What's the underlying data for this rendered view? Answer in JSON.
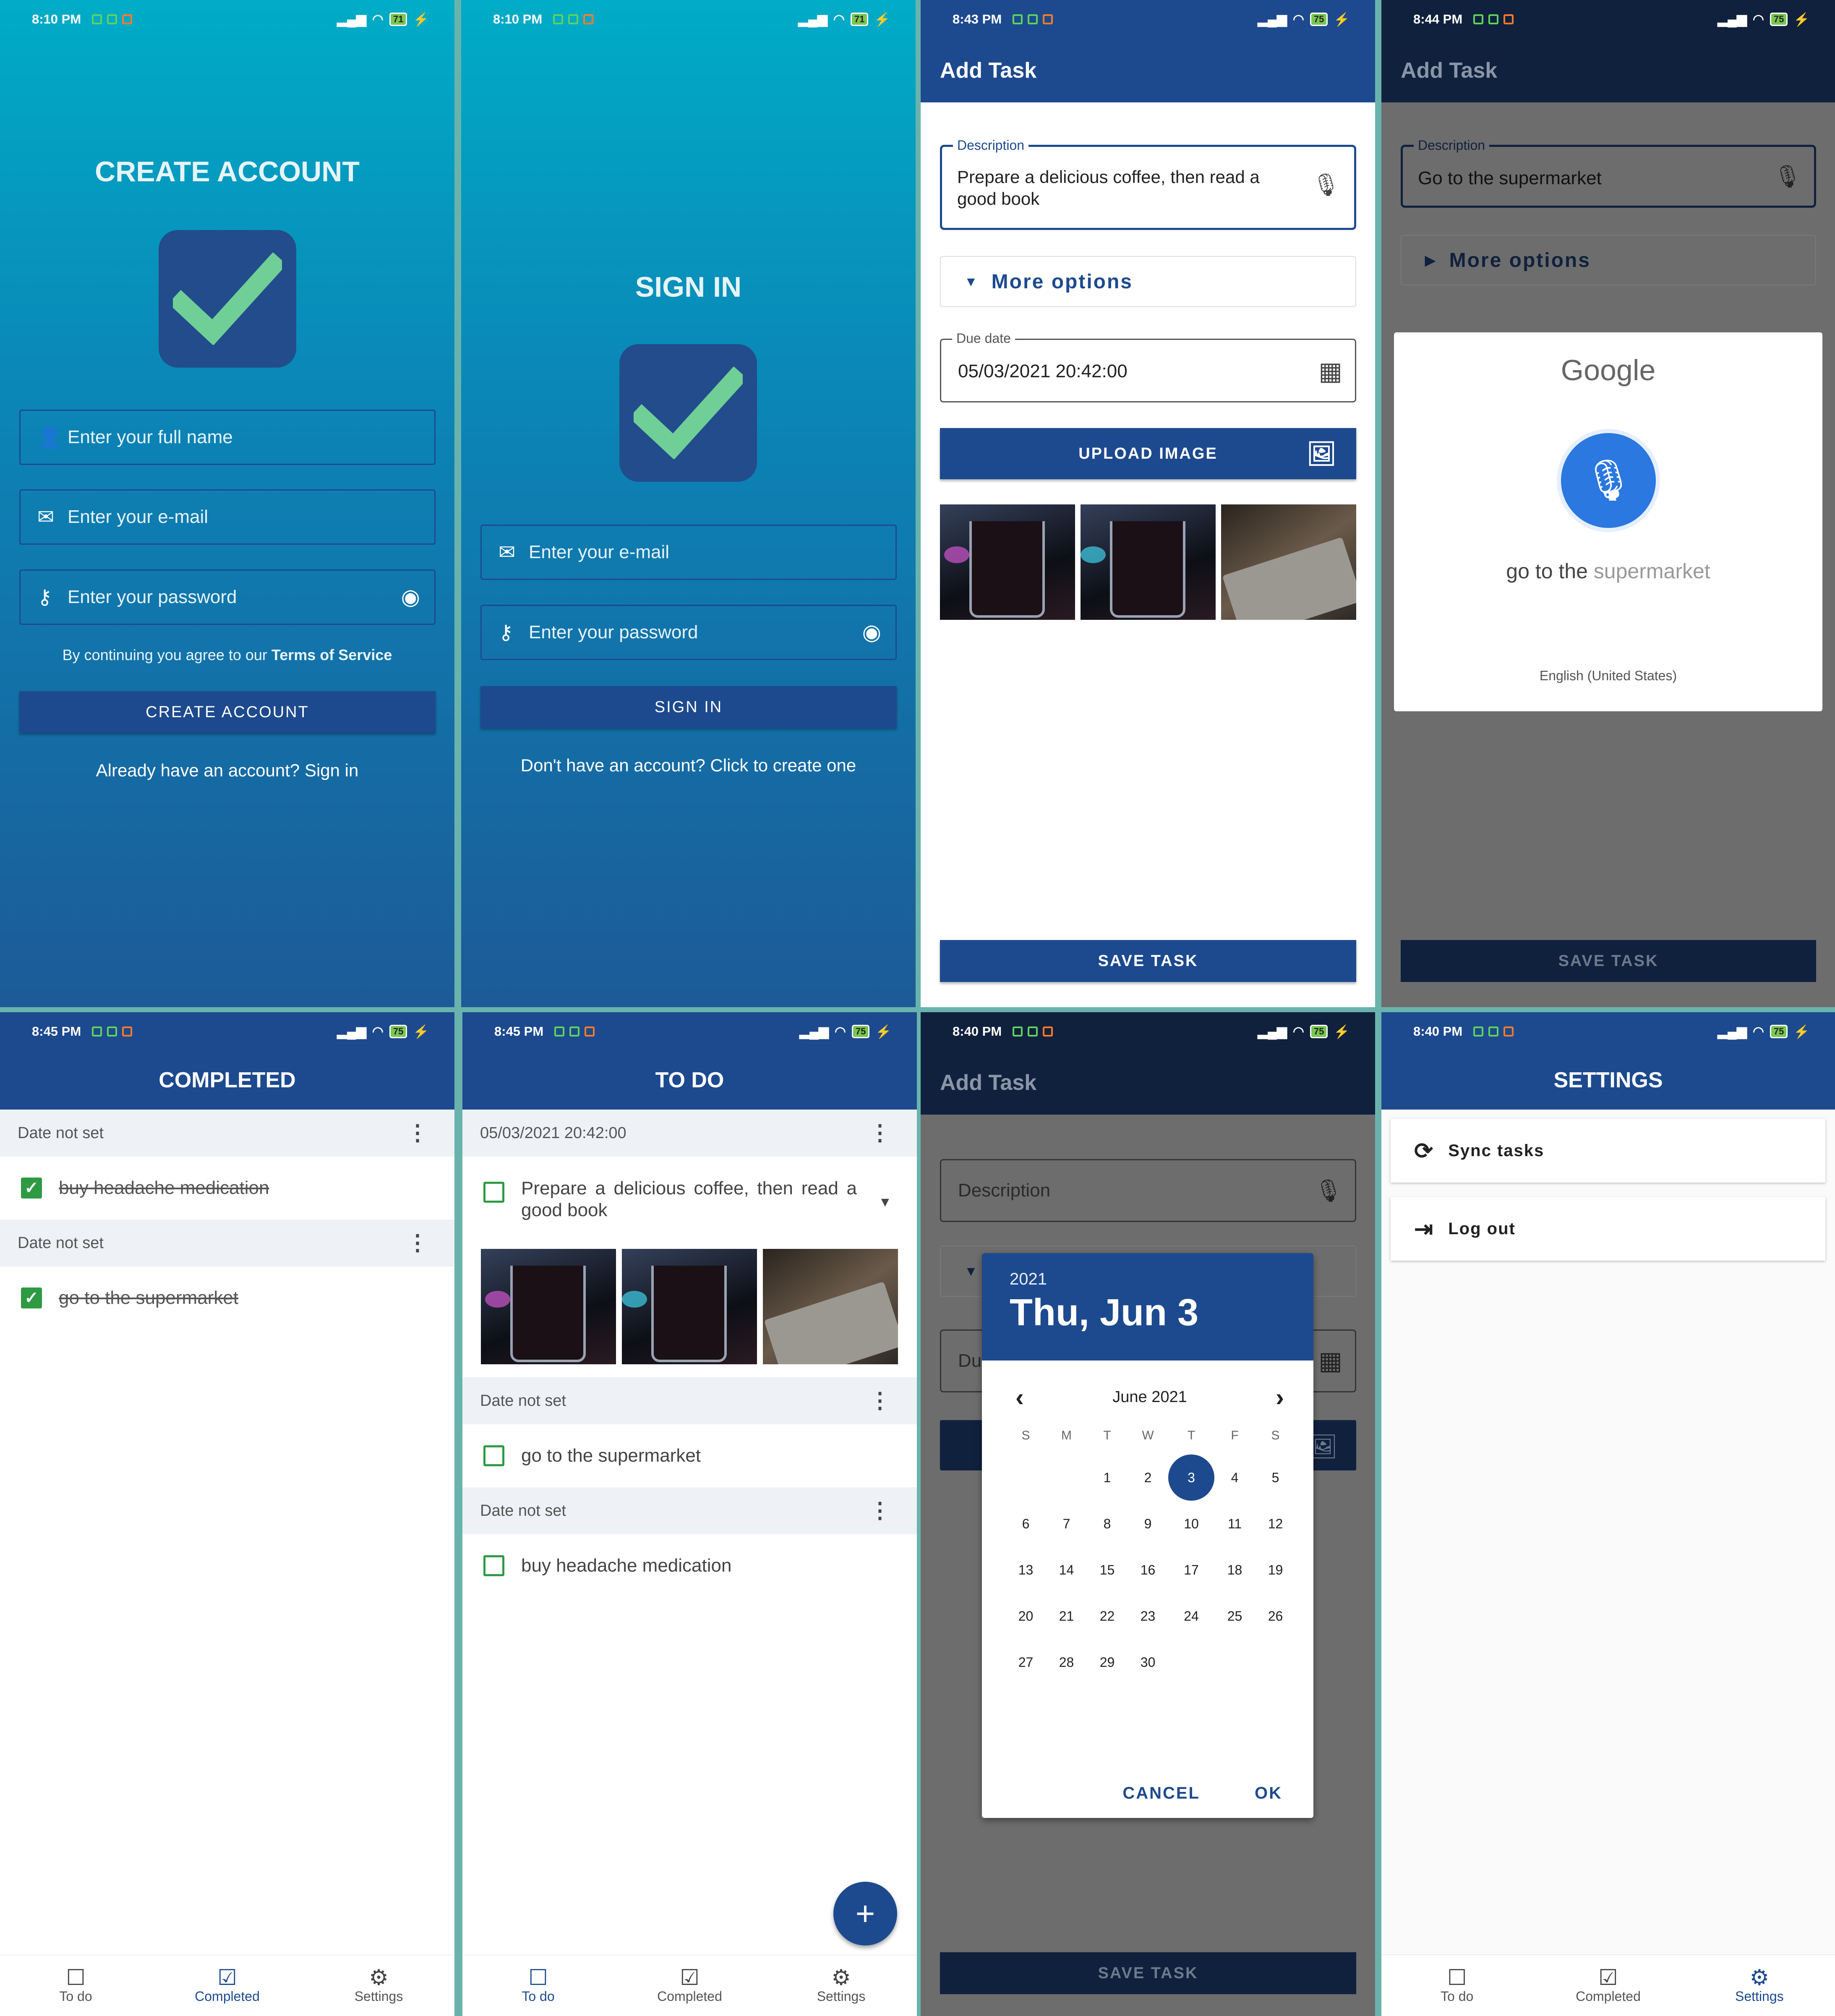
{
  "colors": {
    "primary": "#1d4a8e",
    "success": "#2e9a44",
    "accent": "#6fcf97"
  },
  "create_account": {
    "status_time": "8:10 PM",
    "battery": "71",
    "title": "CREATE ACCOUNT",
    "name_placeholder": "Enter your full name",
    "email_placeholder": "Enter your e-mail",
    "password_placeholder": "Enter your password",
    "terms_prefix": "By continuing you agree to our ",
    "terms_link": "Terms of Service",
    "button": "CREATE ACCOUNT",
    "signin_link": "Already have an account? Sign in"
  },
  "sign_in": {
    "status_time": "8:10 PM",
    "battery": "71",
    "title": "SIGN IN",
    "email_placeholder": "Enter your e-mail",
    "password_placeholder": "Enter your password",
    "button": "SIGN IN",
    "create_link": "Don't have an account? Click to create one"
  },
  "add_task": {
    "status_time": "8:43 PM",
    "battery": "75",
    "title": "Add Task",
    "description_label": "Description",
    "description_value": "Prepare a delicious coffee, then read a good book",
    "more_options": "More options",
    "due_label": "Due date",
    "due_value": "05/03/2021 20:42:00",
    "upload_button": "UPLOAD IMAGE",
    "save_button": "SAVE TASK"
  },
  "voice": {
    "status_time": "8:44 PM",
    "battery": "75",
    "title": "Add Task",
    "description_label": "Description",
    "description_value": "Go to the supermarket",
    "more_options": "More options",
    "save_button": "SAVE TASK",
    "google": "Google",
    "transcript_a": "go to the ",
    "transcript_b": "supermarket",
    "language": "English (United States)"
  },
  "completed": {
    "status_time": "8:45 PM",
    "battery": "75",
    "title": "COMPLETED",
    "sections": [
      {
        "header": "Date not set",
        "item": "buy headache medication"
      },
      {
        "header": "Date not set",
        "item": "go to the supermarket"
      }
    ]
  },
  "todo": {
    "status_time": "8:45 PM",
    "battery": "75",
    "title": "TO DO",
    "sections": [
      {
        "header": "05/03/2021 20:42:00",
        "item": "Prepare a delicious coffee, then read a good book"
      },
      {
        "header": "Date not set",
        "item": "go to the supermarket"
      },
      {
        "header": "Date not set",
        "item": "buy headache medication"
      }
    ]
  },
  "datepicker": {
    "status_time": "8:40 PM",
    "battery": "75",
    "title": "Add Task",
    "description_placeholder": "Description",
    "due_partial": "Du",
    "save_button": "SAVE TASK",
    "year": "2021",
    "date_label": "Thu, Jun 3",
    "month": "June 2021",
    "weekdays": [
      "S",
      "M",
      "T",
      "W",
      "T",
      "F",
      "S"
    ],
    "selected": "3",
    "weeks": [
      [
        "",
        "",
        "1",
        "2",
        "3",
        "4",
        "5"
      ],
      [
        "6",
        "7",
        "8",
        "9",
        "10",
        "11",
        "12"
      ],
      [
        "13",
        "14",
        "15",
        "16",
        "17",
        "18",
        "19"
      ],
      [
        "20",
        "21",
        "22",
        "23",
        "24",
        "25",
        "26"
      ],
      [
        "27",
        "28",
        "29",
        "30",
        "",
        "",
        ""
      ]
    ],
    "cancel": "CANCEL",
    "ok": "OK"
  },
  "settings": {
    "status_time": "8:40 PM",
    "battery": "75",
    "title": "SETTINGS",
    "sync": "Sync tasks",
    "logout": "Log out"
  },
  "nav": {
    "todo": "To do",
    "completed": "Completed",
    "settings": "Settings"
  }
}
